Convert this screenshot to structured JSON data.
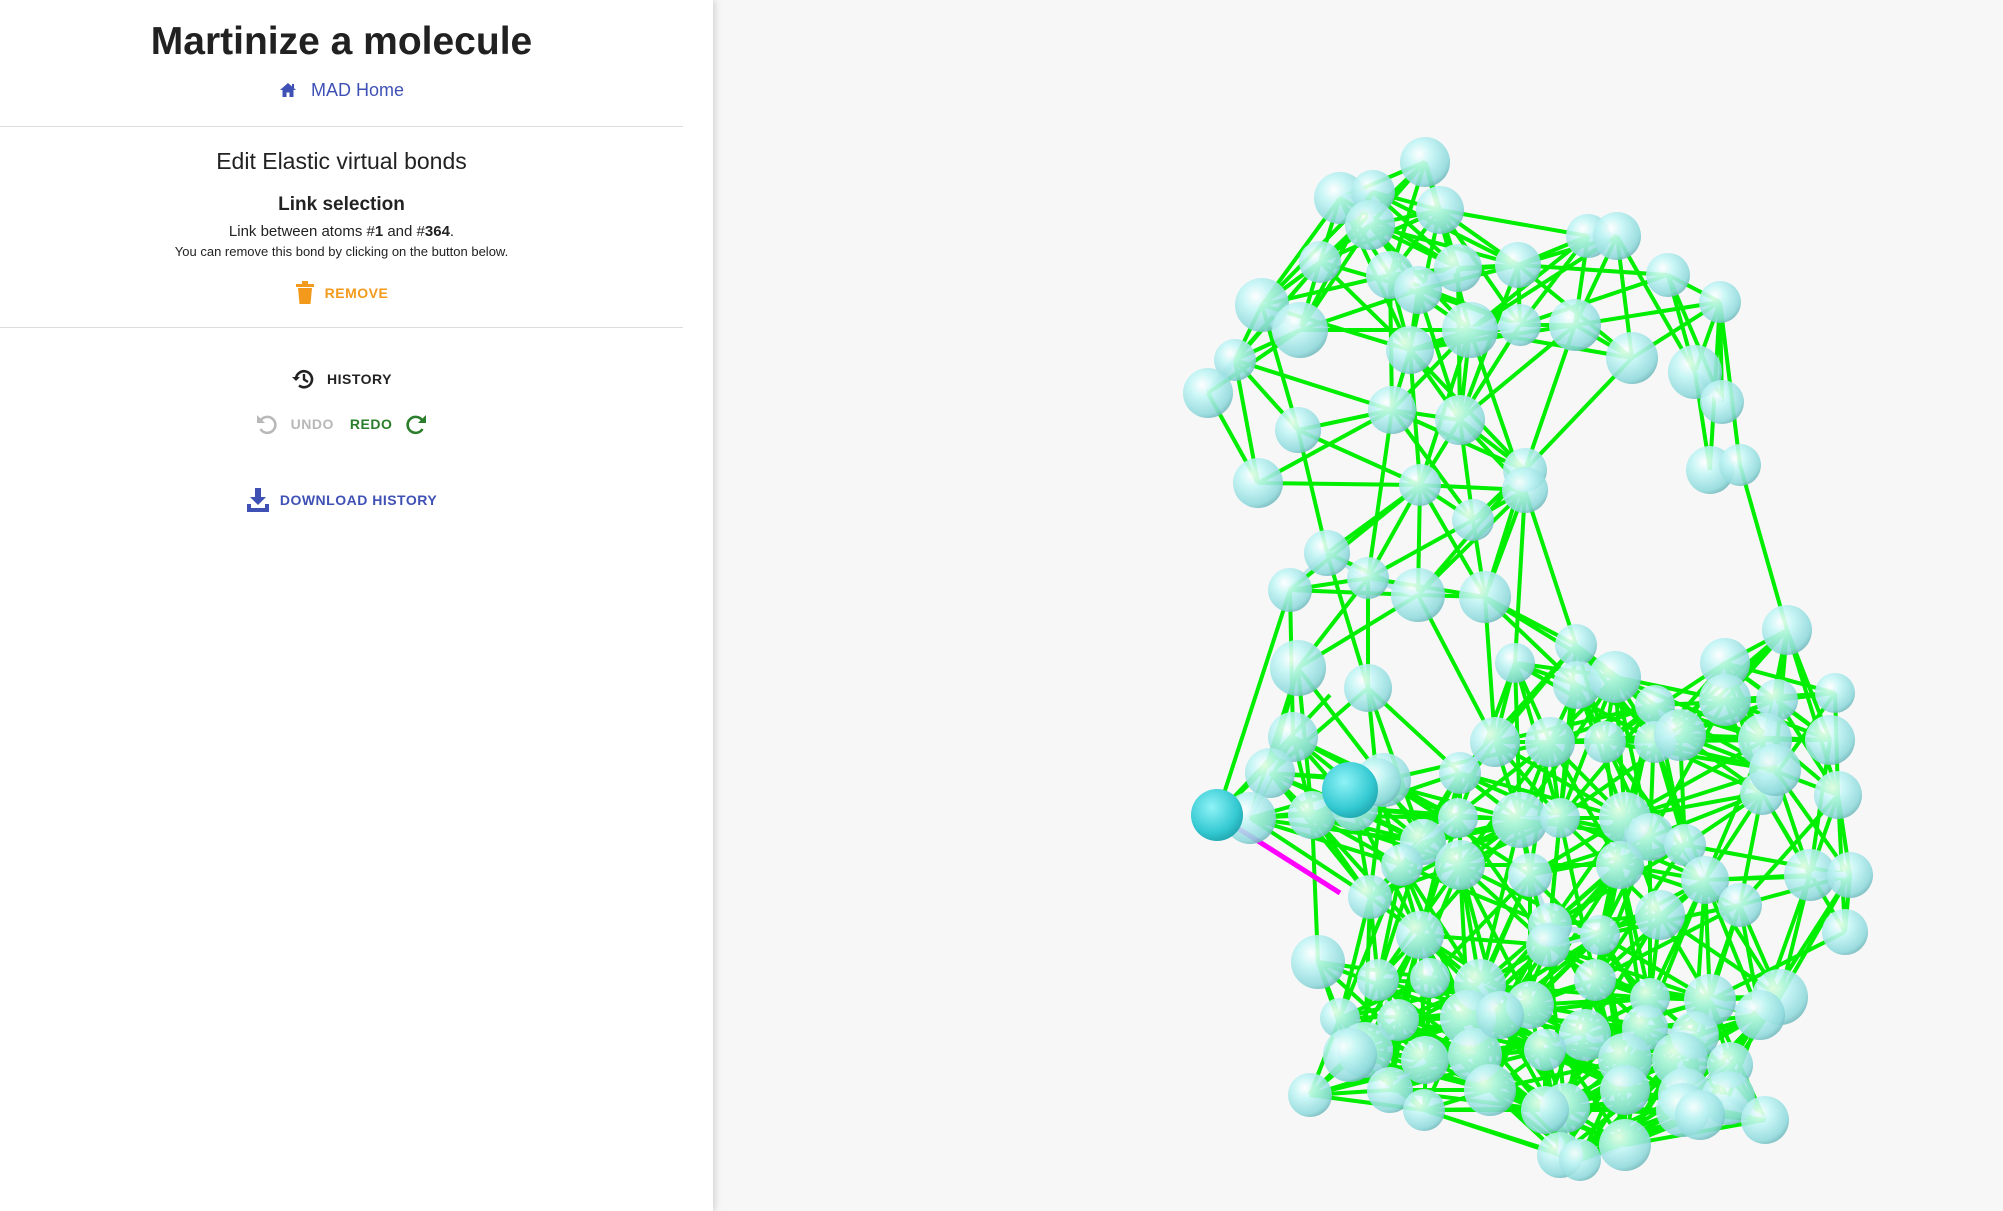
{
  "header": {
    "title": "Martinize a molecule",
    "home_link": "MAD Home"
  },
  "editor": {
    "section_title": "Edit Elastic virtual bonds",
    "selection_title": "Link selection",
    "link_prefix": "Link between atoms #",
    "atom_a": "1",
    "link_mid": " and #",
    "atom_b": "364",
    "link_suffix": ".",
    "hint": "You can remove this bond by clicking on the button below.",
    "remove_label": "REMOVE"
  },
  "history": {
    "label": "HISTORY",
    "undo_label": "UNDO",
    "redo_label": "REDO",
    "download_label": "DOWNLOAD HISTORY"
  },
  "colors": {
    "accent": "#3f51b5",
    "remove": "#f39a1c",
    "redo": "#2a7d2a",
    "bond": "#00ee00",
    "selected_bond": "#ff00ff",
    "atom": "#aef0f0",
    "selected_atom": "#3fd4dc"
  },
  "icons": {
    "home": "home-icon",
    "remove": "trash-icon",
    "history": "history-icon",
    "undo": "undo-icon",
    "redo": "redo-icon",
    "download": "download-icon"
  }
}
